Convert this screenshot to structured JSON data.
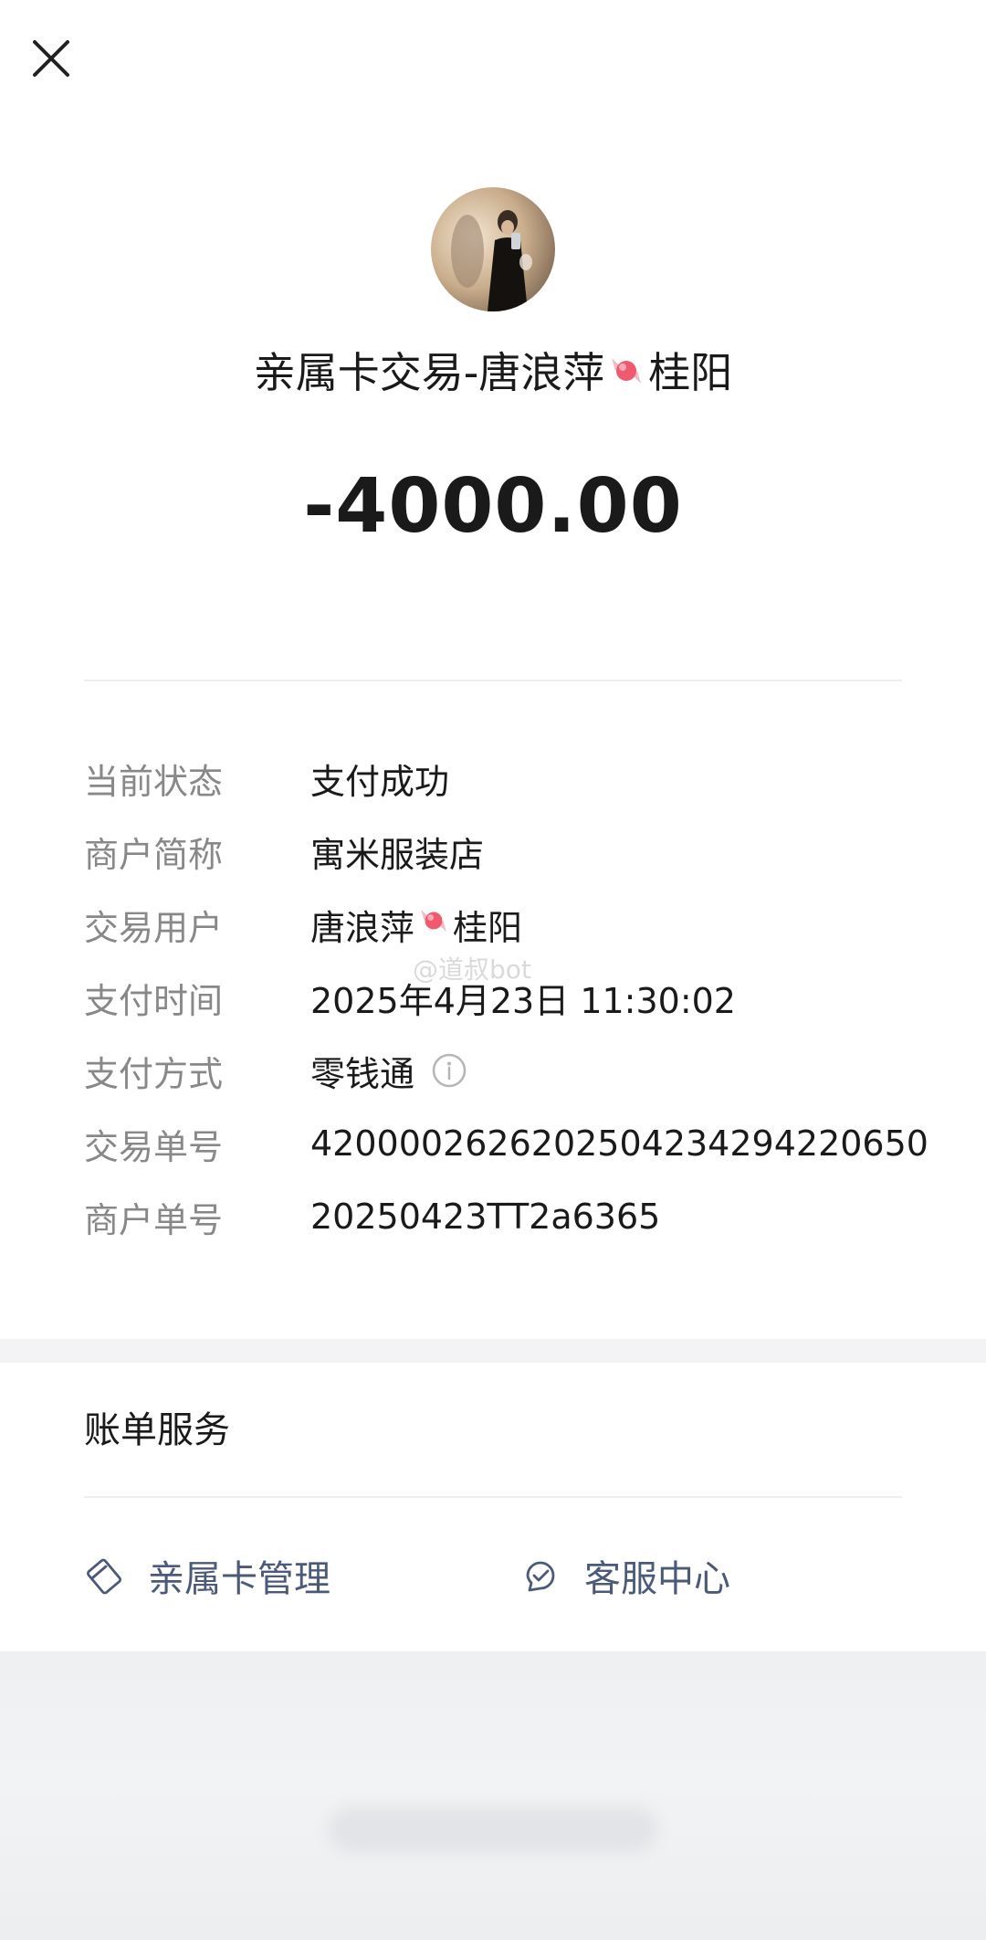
{
  "header": {
    "close_icon": "close-icon",
    "avatar": "avatar-photo",
    "title_prefix": "亲属卡交易-唐浪萍",
    "title_suffix": "桂阳",
    "title_emoji": "candy-emoji",
    "amount": "-4000.00"
  },
  "details": [
    {
      "label": "当前状态",
      "value": "支付成功"
    },
    {
      "label": "商户简称",
      "value": "寓米服装店"
    },
    {
      "label": "交易用户",
      "value_prefix": "唐浪萍",
      "value_suffix": "桂阳"
    },
    {
      "label": "支付时间",
      "value": "2025年4月23日 11:30:02"
    },
    {
      "label": "支付方式",
      "value": "零钱通",
      "icon": "info-icon"
    },
    {
      "label": "交易单号",
      "value": "4200002626202504234294220650"
    },
    {
      "label": "商户单号",
      "value": "20250423TT2a6365"
    }
  ],
  "watermark": "@道叔bot",
  "bill_services": {
    "title": "账单服务",
    "items": [
      {
        "label": "亲属卡管理",
        "icon": "family-card-icon"
      },
      {
        "label": "客服中心",
        "icon": "customer-service-icon"
      }
    ]
  },
  "colors": {
    "label_gray": "#888888",
    "service_link": "#4a5a78",
    "section_band": "#f3f3f5"
  }
}
